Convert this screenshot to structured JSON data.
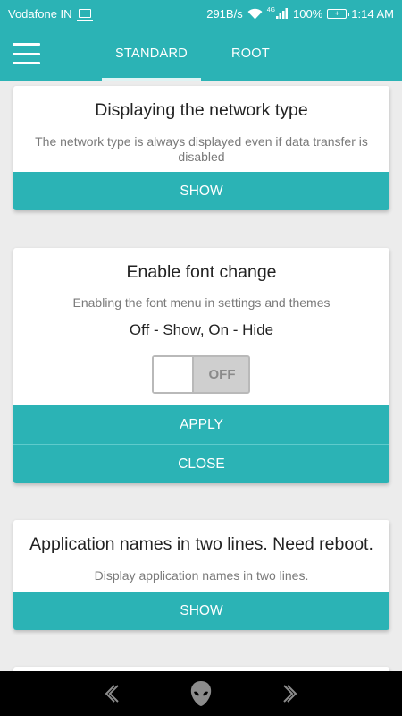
{
  "status_bar": {
    "carrier": "Vodafone IN",
    "net_speed": "291B/s",
    "network_type": "4G",
    "battery": "100%",
    "time": "1:14 AM"
  },
  "tabs": [
    {
      "label": "STANDARD",
      "active": true
    },
    {
      "label": "ROOT",
      "active": false
    }
  ],
  "cards": [
    {
      "title": "Displaying the network type",
      "description": "The network type is always displayed even if data transfer is disabled",
      "button": "SHOW"
    },
    {
      "title": "Enable font change",
      "description": "Enabling the font menu in settings and themes",
      "hint": "Off - Show, On - Hide",
      "toggle_label": "OFF",
      "toggle_on": false,
      "buttons": [
        "APPLY",
        "CLOSE"
      ]
    },
    {
      "title": "Application names in two lines. Need reboot.",
      "description": "Display application names in two lines.",
      "button": "SHOW"
    }
  ],
  "colors": {
    "accent": "#2bb3b5",
    "background": "#ececec",
    "card": "#ffffff",
    "nav_bar": "#000000"
  },
  "icons": [
    "menu-icon",
    "wifi-icon",
    "signal-icon",
    "battery-icon",
    "laptop-icon",
    "back-icon",
    "home-icon",
    "forward-icon"
  ]
}
